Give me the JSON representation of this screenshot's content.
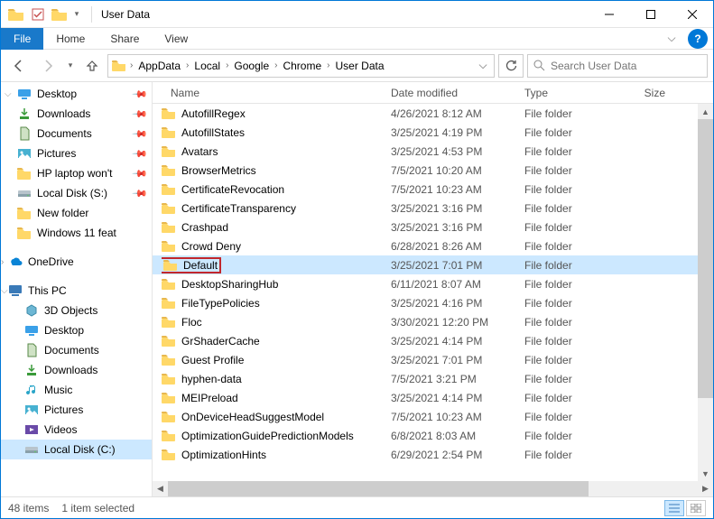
{
  "window": {
    "title": "User Data"
  },
  "ribbon": {
    "file": "File",
    "tabs": [
      "Home",
      "Share",
      "View"
    ]
  },
  "breadcrumbs": [
    "AppData",
    "Local",
    "Google",
    "Chrome",
    "User Data"
  ],
  "search": {
    "placeholder": "Search User Data"
  },
  "nav": {
    "quick": [
      {
        "label": "Desktop",
        "icon": "desktop",
        "pinned": true
      },
      {
        "label": "Downloads",
        "icon": "downloads",
        "pinned": true
      },
      {
        "label": "Documents",
        "icon": "documents",
        "pinned": true
      },
      {
        "label": "Pictures",
        "icon": "pictures",
        "pinned": true
      },
      {
        "label": "HP laptop won't",
        "icon": "folder",
        "pinned": true
      },
      {
        "label": "Local Disk (S:)",
        "icon": "drive",
        "pinned": true
      },
      {
        "label": "New folder",
        "icon": "folder",
        "pinned": false
      },
      {
        "label": "Windows 11 feat",
        "icon": "folder",
        "pinned": false
      }
    ],
    "onedrive": "OneDrive",
    "thispc": "This PC",
    "pc": [
      {
        "label": "3D Objects",
        "icon": "3d"
      },
      {
        "label": "Desktop",
        "icon": "desktop"
      },
      {
        "label": "Documents",
        "icon": "documents"
      },
      {
        "label": "Downloads",
        "icon": "downloads"
      },
      {
        "label": "Music",
        "icon": "music"
      },
      {
        "label": "Pictures",
        "icon": "pictures"
      },
      {
        "label": "Videos",
        "icon": "videos"
      },
      {
        "label": "Local Disk (C:)",
        "icon": "drive",
        "selected": true
      }
    ]
  },
  "columns": {
    "name": "Name",
    "date": "Date modified",
    "type": "Type",
    "size": "Size"
  },
  "files": [
    {
      "name": "AutofillRegex",
      "date": "4/26/2021 8:12 AM",
      "type": "File folder"
    },
    {
      "name": "AutofillStates",
      "date": "3/25/2021 4:19 PM",
      "type": "File folder"
    },
    {
      "name": "Avatars",
      "date": "3/25/2021 4:53 PM",
      "type": "File folder"
    },
    {
      "name": "BrowserMetrics",
      "date": "7/5/2021 10:20 AM",
      "type": "File folder"
    },
    {
      "name": "CertificateRevocation",
      "date": "7/5/2021 10:23 AM",
      "type": "File folder"
    },
    {
      "name": "CertificateTransparency",
      "date": "3/25/2021 3:16 PM",
      "type": "File folder"
    },
    {
      "name": "Crashpad",
      "date": "3/25/2021 3:16 PM",
      "type": "File folder"
    },
    {
      "name": "Crowd Deny",
      "date": "6/28/2021 8:26 AM",
      "type": "File folder"
    },
    {
      "name": "Default",
      "date": "3/25/2021 7:01 PM",
      "type": "File folder",
      "selected": true,
      "highlight": true
    },
    {
      "name": "DesktopSharingHub",
      "date": "6/11/2021 8:07 AM",
      "type": "File folder"
    },
    {
      "name": "FileTypePolicies",
      "date": "3/25/2021 4:16 PM",
      "type": "File folder"
    },
    {
      "name": "Floc",
      "date": "3/30/2021 12:20 PM",
      "type": "File folder"
    },
    {
      "name": "GrShaderCache",
      "date": "3/25/2021 4:14 PM",
      "type": "File folder"
    },
    {
      "name": "Guest Profile",
      "date": "3/25/2021 7:01 PM",
      "type": "File folder"
    },
    {
      "name": "hyphen-data",
      "date": "7/5/2021 3:21 PM",
      "type": "File folder"
    },
    {
      "name": "MEIPreload",
      "date": "3/25/2021 4:14 PM",
      "type": "File folder"
    },
    {
      "name": "OnDeviceHeadSuggestModel",
      "date": "7/5/2021 10:23 AM",
      "type": "File folder"
    },
    {
      "name": "OptimizationGuidePredictionModels",
      "date": "6/8/2021 8:03 AM",
      "type": "File folder"
    },
    {
      "name": "OptimizationHints",
      "date": "6/29/2021 2:54 PM",
      "type": "File folder"
    }
  ],
  "status": {
    "count": "48 items",
    "selected": "1 item selected"
  }
}
